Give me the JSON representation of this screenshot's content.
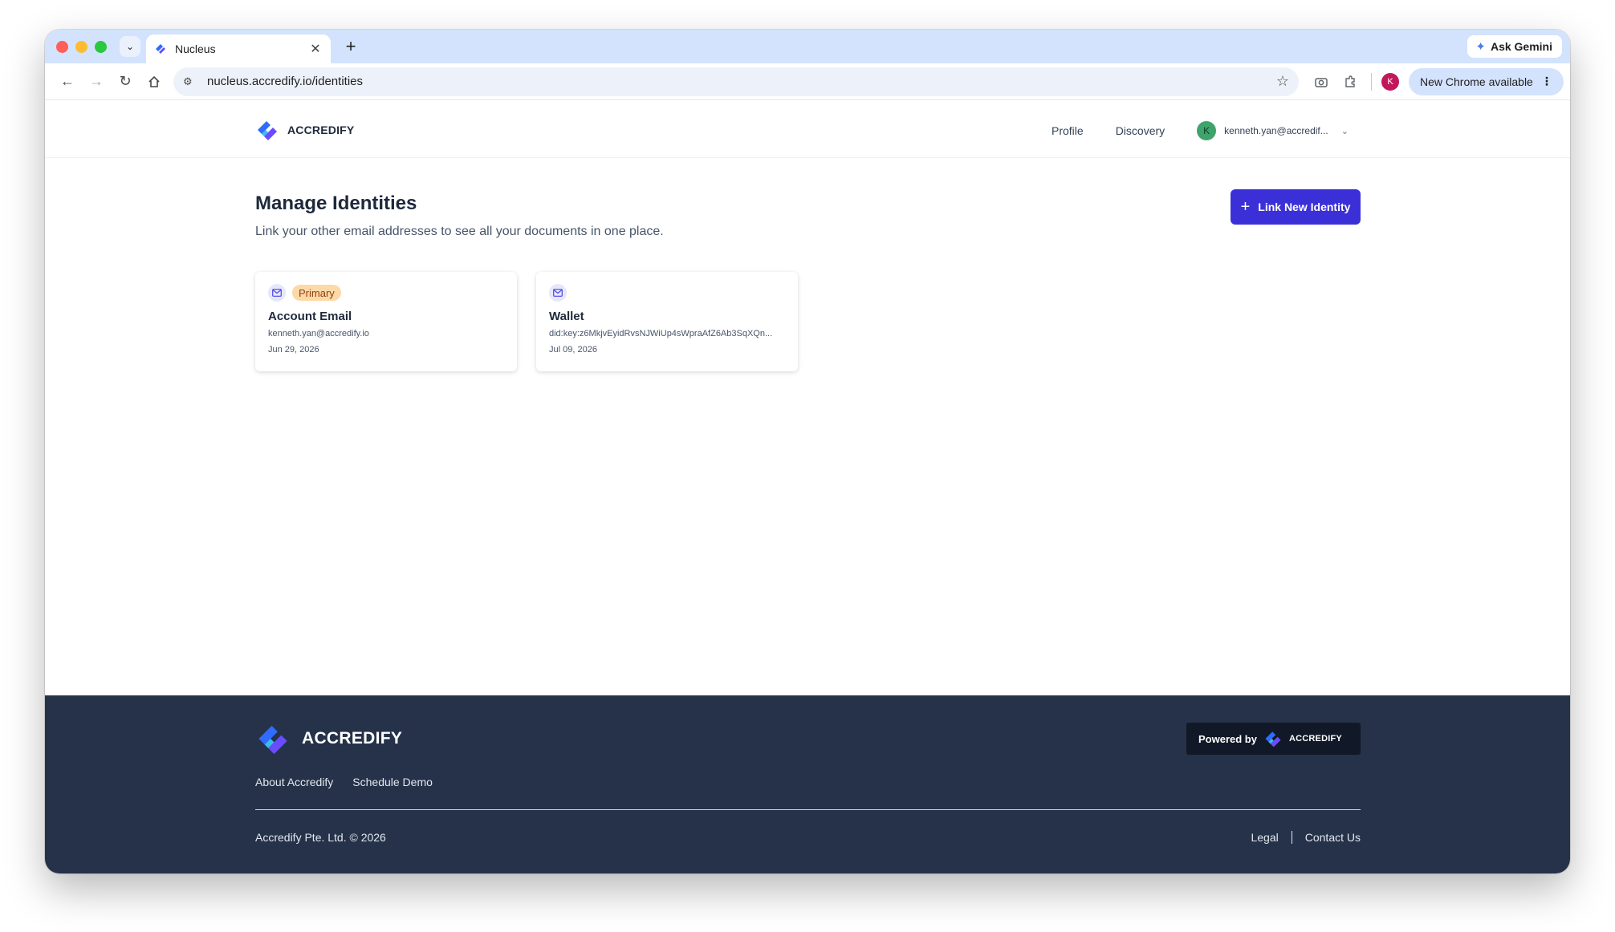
{
  "browser": {
    "tab_title": "Nucleus",
    "url": "nucleus.accredify.io/identities",
    "ask_gemini": "Ask Gemini",
    "profile_initial": "K",
    "update_label": "New Chrome available"
  },
  "header": {
    "brand": "ACCREDIFY",
    "nav": {
      "profile": "Profile",
      "discovery": "Discovery"
    },
    "user": {
      "initial": "K",
      "email": "kenneth.yan@accredif..."
    }
  },
  "main": {
    "title": "Manage Identities",
    "subtitle": "Link your other email addresses to see all your documents in one place.",
    "link_button": "Link New Identity",
    "cards": [
      {
        "badge": "Primary",
        "title": "Account Email",
        "value": "kenneth.yan@accredify.io",
        "date": "Jun 29, 2026"
      },
      {
        "badge": "",
        "title": "Wallet",
        "value": "did:key:z6MkjvEyidRvsNJWiUp4sWpraAfZ6Ab3SqXQn...",
        "date": "Jul 09, 2026"
      }
    ]
  },
  "footer": {
    "brand": "ACCREDIFY",
    "powered_label": "Powered by",
    "powered_brand": "ACCREDIFY",
    "links": {
      "about": "About Accredify",
      "demo": "Schedule Demo"
    },
    "copyright": "Accredify Pte. Ltd. © 2026",
    "legal": "Legal",
    "contact": "Contact Us"
  },
  "colors": {
    "primary_button": "#3b30d8",
    "footer_bg": "#253249",
    "badge_bg": "#fdd9a8",
    "user_avatar": "#3fa46b"
  }
}
